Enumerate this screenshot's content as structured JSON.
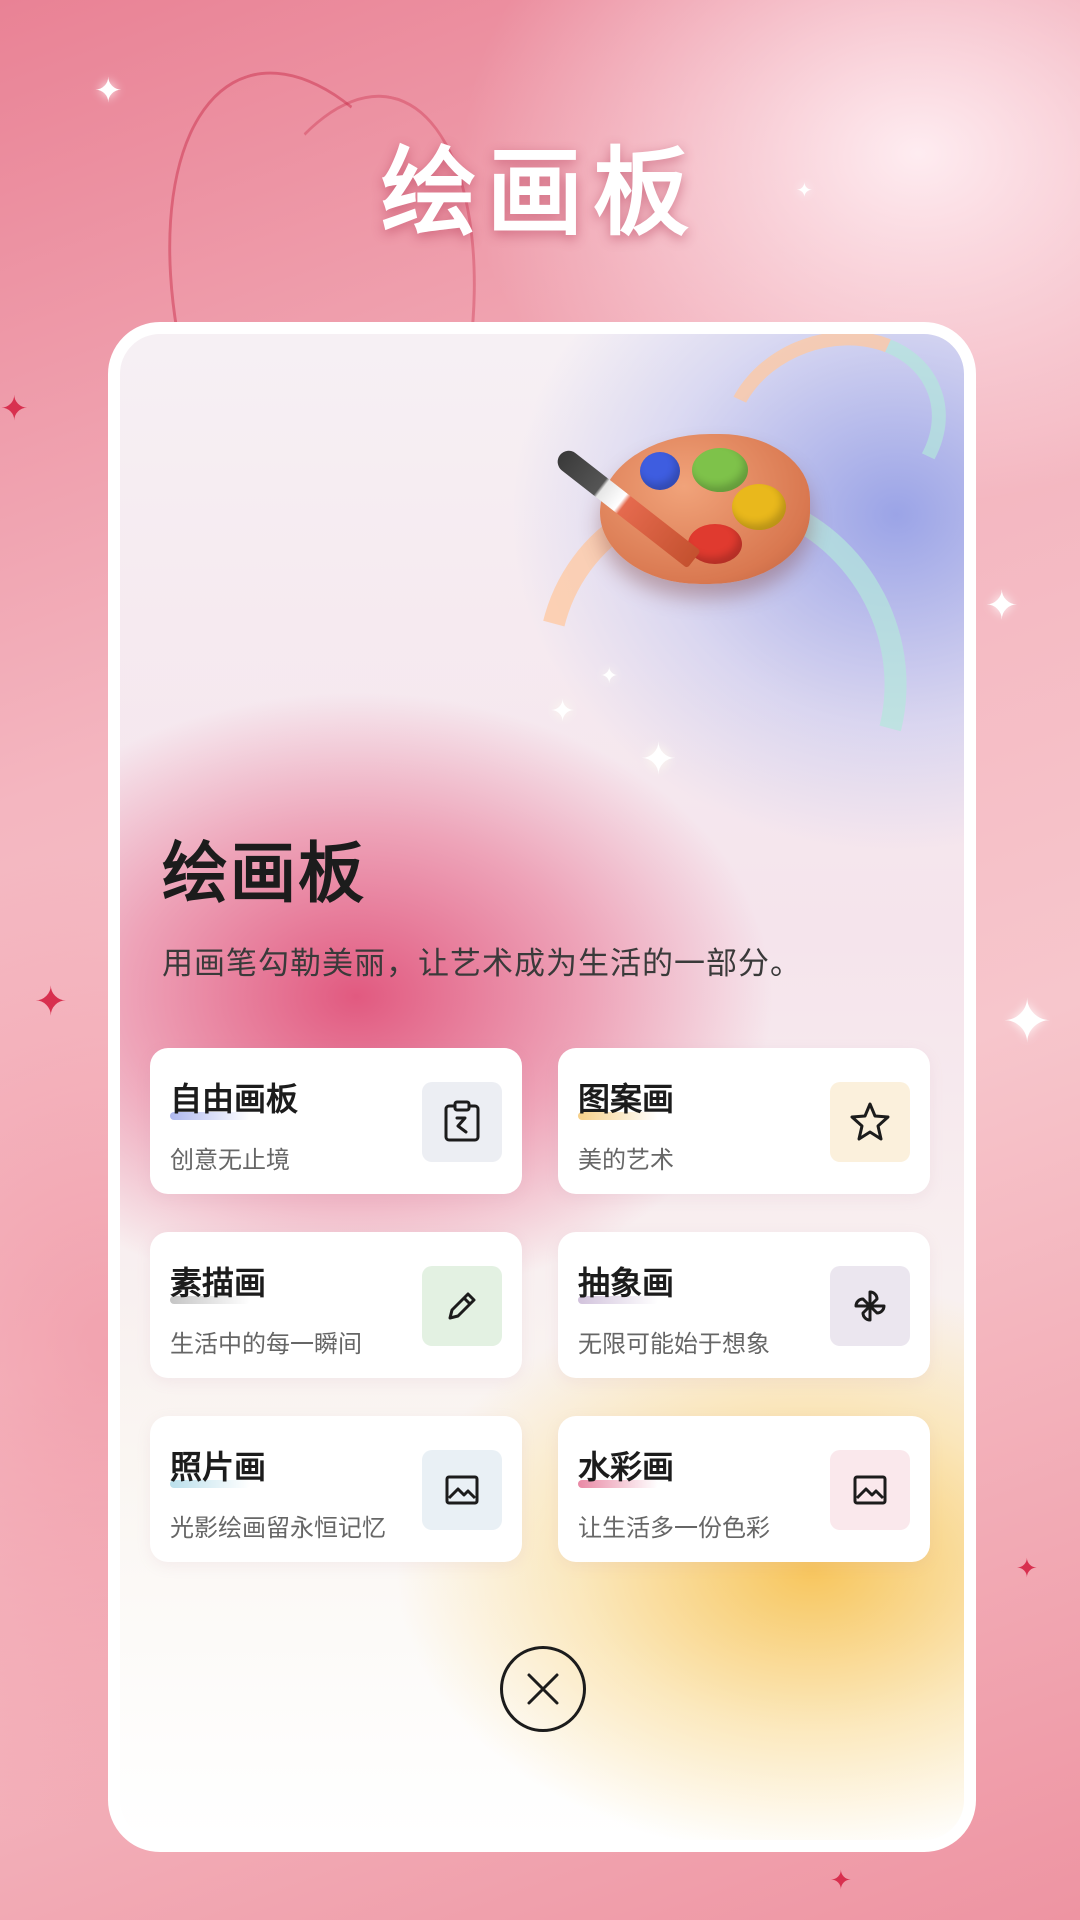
{
  "banner": {
    "title": "绘画板"
  },
  "card": {
    "title": "绘画板",
    "subtitle": "用画笔勾勒美丽，让艺术成为生活的一部分。"
  },
  "modes": [
    {
      "title": "自由画板",
      "desc": "创意无止境",
      "icon": "clipboard-icon",
      "icon_bg": "#eceef3",
      "accent": "#9aa6ea"
    },
    {
      "title": "图案画",
      "desc": "美的艺术",
      "icon": "star-icon",
      "icon_bg": "#fbf0dc",
      "accent": "#f3c36a"
    },
    {
      "title": "素描画",
      "desc": "生活中的每一瞬间",
      "icon": "pencil-icon",
      "icon_bg": "#e3f1e2",
      "accent": "#b6b6b6"
    },
    {
      "title": "抽象画",
      "desc": "无限可能始于想象",
      "icon": "pinwheel-icon",
      "icon_bg": "#ebe6ef",
      "accent": "#c6b3d3"
    },
    {
      "title": "照片画",
      "desc": "光影绘画留永恒记忆",
      "icon": "image-icon",
      "icon_bg": "#e9f0f5",
      "accent": "#a9d7e6"
    },
    {
      "title": "水彩画",
      "desc": "让生活多一份色彩",
      "icon": "image-icon",
      "icon_bg": "#fae8ec",
      "accent": "#e36b8e"
    }
  ],
  "close": {
    "icon": "close-icon"
  }
}
